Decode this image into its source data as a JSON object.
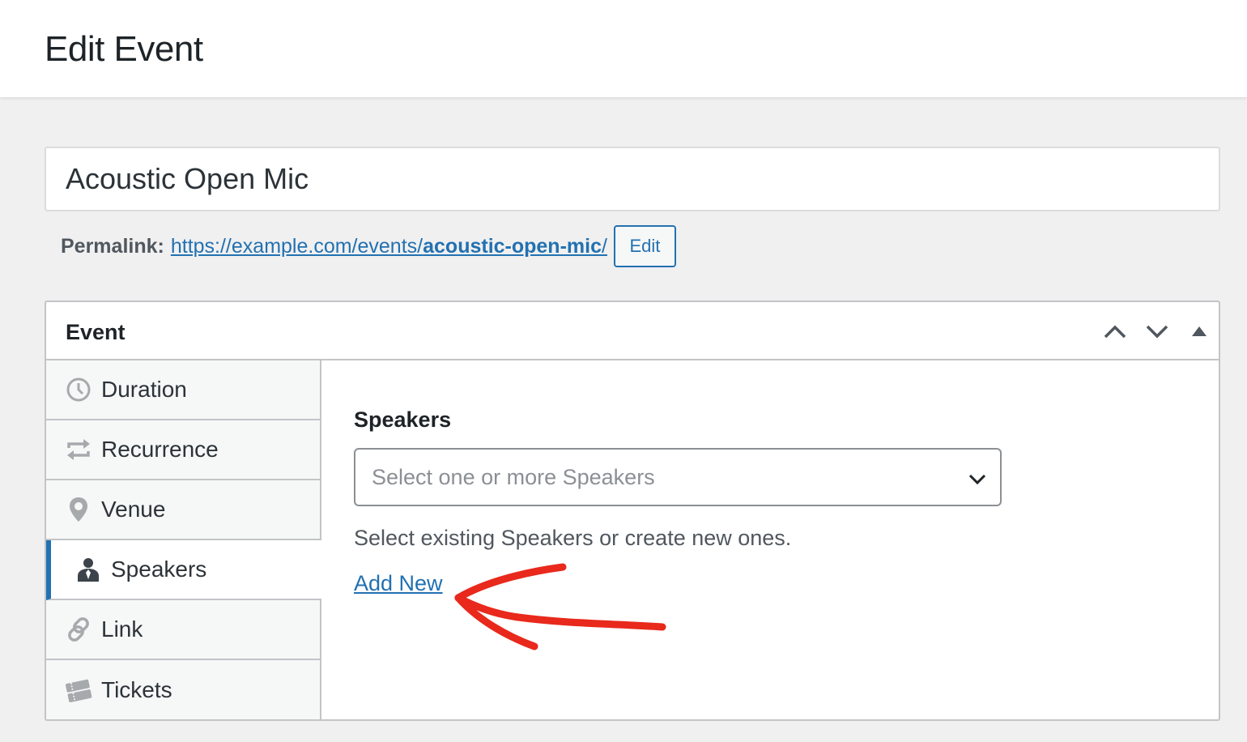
{
  "header": {
    "title": "Edit Event"
  },
  "post": {
    "title_value": "Acoustic Open Mic",
    "permalink": {
      "label": "Permalink:",
      "url_base": "https://example.com/events/",
      "url_slug": "acoustic-open-mic",
      "url_trail": "/",
      "edit_label": "Edit"
    }
  },
  "metabox": {
    "title": "Event",
    "controls": [
      "chevron-up-icon",
      "chevron-down-icon",
      "triangle-up-icon"
    ],
    "tabs": [
      {
        "label": "Duration",
        "icon": "clock-icon",
        "active": false
      },
      {
        "label": "Recurrence",
        "icon": "repeat-icon",
        "active": false
      },
      {
        "label": "Venue",
        "icon": "location-pin-icon",
        "active": false
      },
      {
        "label": "Speakers",
        "icon": "person-icon",
        "active": true
      },
      {
        "label": "Link",
        "icon": "link-icon",
        "active": false
      },
      {
        "label": "Tickets",
        "icon": "tickets-icon",
        "active": false
      }
    ],
    "speakers": {
      "label": "Speakers",
      "select_placeholder": "Select one or more Speakers",
      "help_text": "Select existing Speakers or create new ones.",
      "add_new_label": "Add New"
    }
  },
  "colors": {
    "accent": "#2271b1",
    "annotation_arrow": "#e8291c",
    "background": "#f0f0f1",
    "border": "#c3c4c7"
  }
}
